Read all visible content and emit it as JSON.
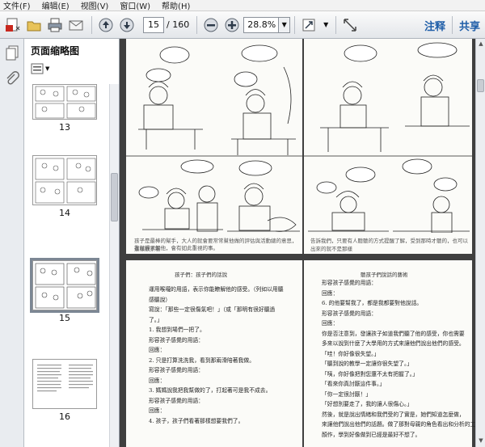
{
  "menu": [
    "文件(F)",
    "编辑(E)",
    "视图(V)",
    "窗口(W)",
    "帮助(H)"
  ],
  "toolbar": {
    "current_page": "15",
    "total_pages": "/ 160",
    "zoom": "28.8%",
    "comment": "注释",
    "share": "共享"
  },
  "thumbnails": {
    "title": "页面缩略图",
    "items": [
      {
        "label": "13"
      },
      {
        "label": "14"
      },
      {
        "label": "15"
      },
      {
        "label": "16"
      }
    ]
  },
  "document": {
    "top_left_caption": "孩子是最棒的幫手，大人的就會要常常幫他做的評估與活動總的意思，這樣觀察看",
    "top_left_caption2": "看就得了解他，會有如此重視的事。",
    "top_right_caption": "告訴我們，只要有人聽聽的方式提醒了解，受到那時才聽的，也可以出來的就不是那樣",
    "bottom_left_header": "孩子們：孩子們的話說",
    "bottom_right_header": "聽孩子們說話的藝術",
    "bottom_left_lines": [
      "運用喉嚨的用語，表示你能瞭解他的感受。（列如以用聽",
      "感聽說）",
      "寫說：「那些一定很傷氣吧！」（或「那明有很好聽過",
      "了。」",
      "1. 我想到場們一把了。",
      "形容孩子感覺的用語：",
      "回應：",
      "2. 只是打算洗洗我，看到那兩滑陪著我做。",
      "形容孩子感覺的用語：",
      "回應：",
      "3. 媽媽說我把我幫做的了，打起著可是我不成去。",
      "形容孩子感覺的用語：",
      "回應：",
      "4. 孩子，孩子們看著那樣想要我們了。"
    ],
    "bottom_right_lines": [
      "形容孩子感覺的用語：",
      "回應：",
      "6. 的他要幫我了，都是我都要對他說話。",
      "形容孩子感覺的用語：",
      "回應：",
      "你是否注意到，發讓孩子如道我們聽了他的感受，你也需要",
      "多來以說到什麼了大學用的方式來讓他們說出他們的感受。",
      "「哇！你好像很失望。」",
      "「聽到說的教學一定讓你很失望了。」",
      "「咦，你好像把對您還不太有把握了。」",
      "「看來你真討厭這件事。」",
      "「你一定很討厭！」",
      "「好想別要走了，我的讓人很傷心。」",
      "然後，就是說出情緒和我們受的了實是，她們知道怎麼做，",
      "來讓他們說出他們的話題。做了那對母親的角色看出和分析的工",
      "顏作，學到好像做到已經是最好不想了。"
    ]
  }
}
